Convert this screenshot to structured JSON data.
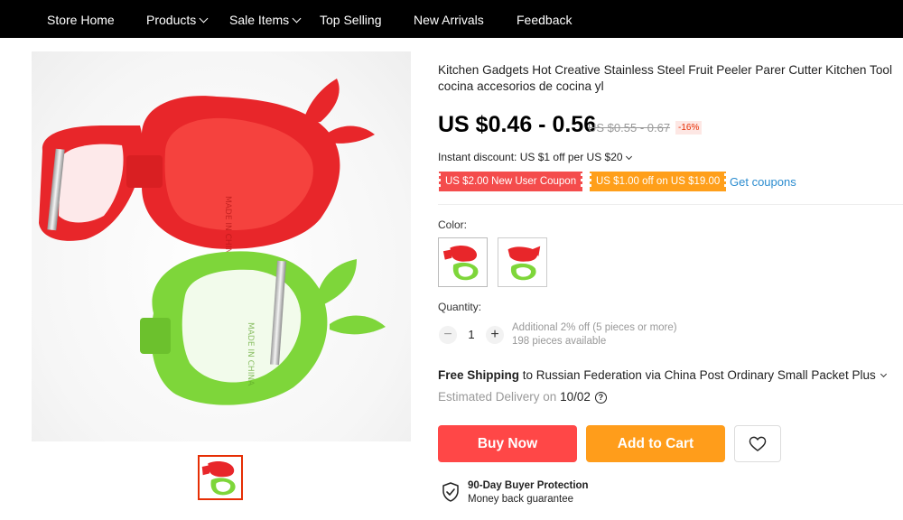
{
  "nav": {
    "items": [
      {
        "label": "Store Home",
        "dropdown": false
      },
      {
        "label": "Products",
        "dropdown": true
      },
      {
        "label": "Sale Items",
        "dropdown": true
      },
      {
        "label": "Top Selling",
        "dropdown": false
      },
      {
        "label": "New Arrivals",
        "dropdown": false
      },
      {
        "label": "Feedback",
        "dropdown": false
      }
    ]
  },
  "product": {
    "title": "Kitchen Gadgets Hot Creative Stainless Steel Fruit Peeler Parer Cutter Kitchen Tool cocina accesorios de cocina yl",
    "price": "US $0.46 - 0.56",
    "original_price": "US $0.55 - 0.67",
    "discount": "-16%",
    "instant_discount": "Instant discount: US $1 off per US $20"
  },
  "coupons": {
    "new_user": "US $2.00 New User Coupon",
    "store": "US $1.00 off on US $19.00",
    "get_coupons_link": "Get coupons"
  },
  "variants": {
    "color_label": "Color:"
  },
  "quantity": {
    "label": "Quantity:",
    "value": "1",
    "minus": "−",
    "plus": "+",
    "promo_note": "Additional 2% off (5 pieces or more)",
    "availability": "198 pieces available"
  },
  "shipping": {
    "free_label": "Free Shipping",
    "destination_text": "to Russian Federation via China Post Ordinary Small Packet Plus",
    "estimated_label": "Estimated Delivery on",
    "estimated_date": "10/02",
    "help_glyph": "?"
  },
  "actions": {
    "buy_now": "Buy Now",
    "add_to_cart": "Add to Cart",
    "wishlist_icon": "heart-icon"
  },
  "protection": {
    "title": "90-Day Buyer Protection",
    "subtitle": "Money back guarantee",
    "icon": "shield-check-icon"
  },
  "colors": {
    "nav_bg": "#000000",
    "buy_now": "#ff4747",
    "add_to_cart": "#ff9d1b",
    "coupon_red": "#f44c4c",
    "coupon_orange": "#ff9f1a",
    "link": "#2b8ccf",
    "peeler_red": "#e8262a",
    "peeler_green": "#7ed63a"
  }
}
